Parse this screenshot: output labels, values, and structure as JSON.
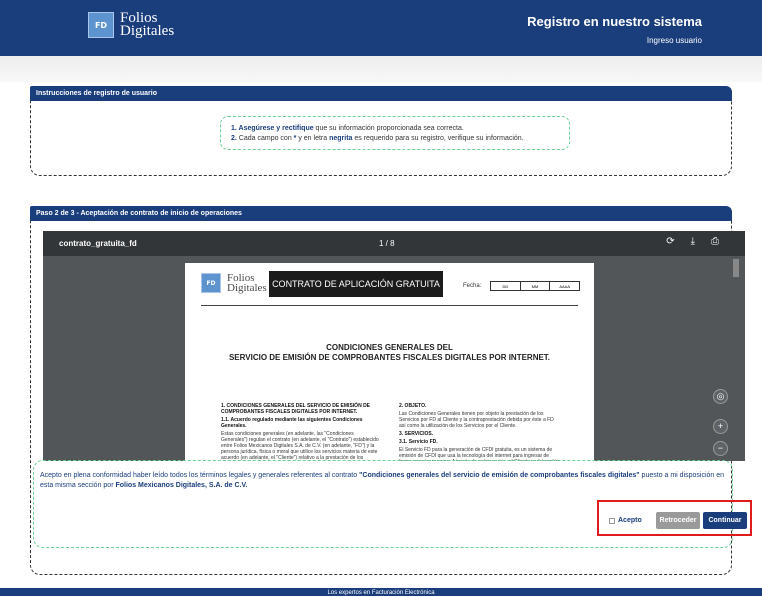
{
  "header": {
    "logo_line1": "Folios",
    "logo_line2": "Digitales",
    "logo_mark": "FD",
    "title": "Registro en nuestro sistema",
    "subtitle": "Ingreso usuario"
  },
  "panel1": {
    "title": "Instrucciones de registro de usuario",
    "item1_bold": "1. Asegúrese y rectifique",
    "item1_rest": " que su información proporcionada sea correcta.",
    "item2_pre": "2.",
    "item2_a": " Cada campo con ",
    "item2_star": "*",
    "item2_b": " y en letra ",
    "item2_bold": "negrita",
    "item2_c": " es requerido para su registro, verifique su información."
  },
  "panel2": {
    "title": "Paso 2 de 3 - Aceptación de contrato de inicio de operaciones"
  },
  "viewer": {
    "filename": "contrato_gratuita_fd",
    "page": "1 / 8"
  },
  "doc": {
    "header": "CONTRATO DE APLICACIÓN GRATUITA",
    "fecha": "Fecha:",
    "dd": "DD",
    "mm": "MM",
    "aaaa": "AAAA",
    "title1": "CONDICIONES GENERALES DEL",
    "title2": "SERVICIO DE EMISIÓN DE COMPROBANTES FISCALES DIGITALES POR INTERNET.",
    "c1_h1": "1. CONDICIONES GENERALES DEL SERVICIO DE EMISIÓN DE COMPROBANTES FISCALES DIGITALES POR INTERNET.",
    "c1_h2": "1.1. Acuerdo regulado mediante las siguientes Condiciones Generales.",
    "c1_p": "Estas condiciones generales (en adelante, las \"Condiciones Generales\") regulan el contrato (en adelante, el \"Contrato\") establecido entre Folios Mexicanos Digitales S.A. de C.V. (en adelante, \"FD\") y la persona jurídica, física o moral que utilice los servicios materia de este acuerdo (en adelante, el \"Cliente\") relativo a la prestación de los siguientes servicios (en adelante, los \"Servicios\"): el servicio de emisión de Comprobantes",
    "c2_h1": "2. OBJETO.",
    "c2_p1": "Las Condiciones Generales tienen por objeto la prestación de los Servicios por FD al Cliente y la contraprestación debida por éste a FD así como la utilización de los Servicios por el Cliente.",
    "c2_h2": "3. SERVICIOS.",
    "c2_h3": "3.1. Servicio FD.",
    "c2_p2": "El Servicio FD para la generación de CFDI gratuita, es un sistema de emisión de CFDI que usa la tecnología del internet para ingresar de forma remota y segura. A través de este servicio, el Cliente podrá emitir CFDI, enviarlos a sus respectivos clientes por medio del correo electrónico, imprimir los"
  },
  "accept": {
    "pre": "Acepto en plena conformidad haber leído todos los términos legales y generales referentes al contrato ",
    "bold": "\"Condiciones generales del servicio de emisión de comprobantes fiscales digitales\"",
    "mid": " puesto a mi disposición en esta misma sección por ",
    "company": "Folios Mexicanos Digitales, S.A. de C.V.",
    "check_label": "Acepto",
    "back": "Retroceder",
    "next": "Continuar"
  },
  "footer": {
    "text": "Los expertos en Facturación Electrónica"
  }
}
